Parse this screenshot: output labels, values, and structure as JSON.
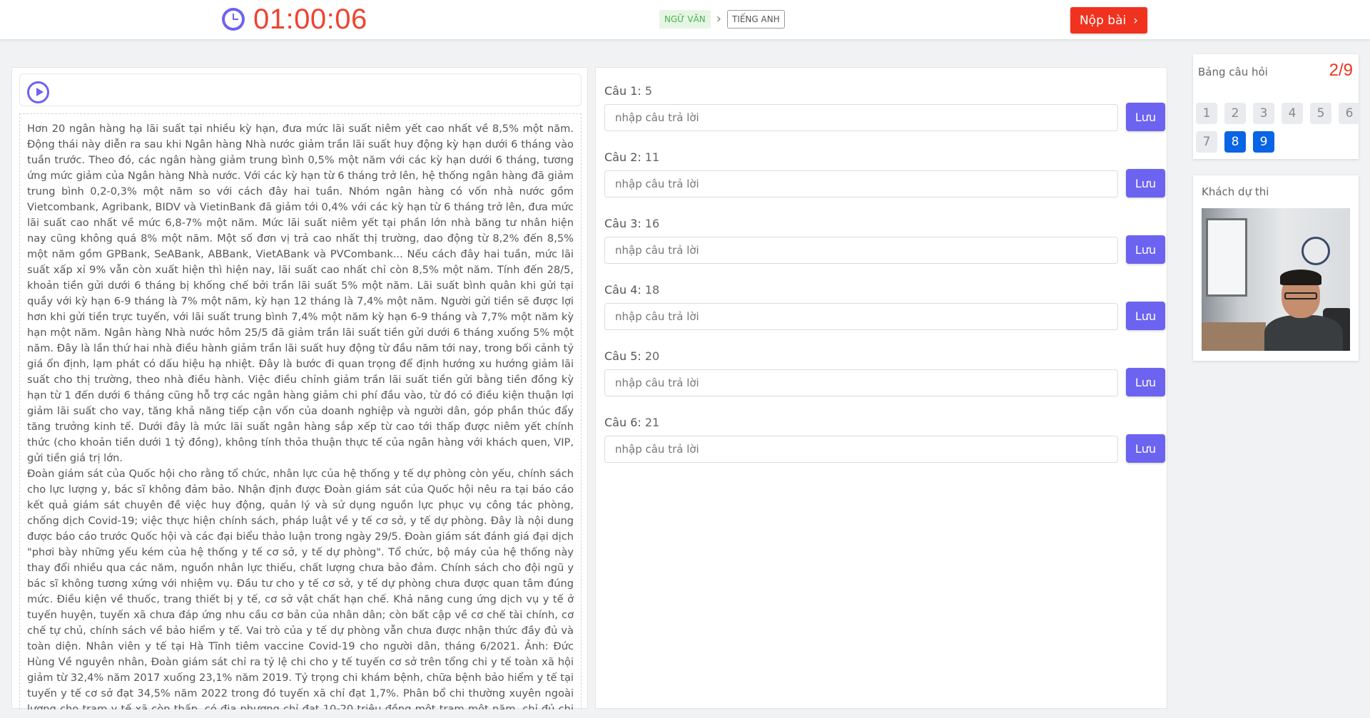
{
  "header": {
    "timer": "01:00:06",
    "subjects": [
      "NGỮ VĂN",
      "TIẾNG ANH"
    ],
    "submit_label": "Nộp bài",
    "submit_arrow": "›"
  },
  "passage": {
    "paragraphs": [
      "Hơn 20 ngân hàng hạ lãi suất tại nhiều kỳ hạn, đưa mức lãi suất niêm yết cao nhất về 8,5% một năm. Động thái này diễn ra sau khi Ngân hàng Nhà nước giảm trần lãi suất huy động kỳ hạn dưới 6 tháng vào tuần trước. Theo đó, các ngân hàng giảm trung bình 0,5% một năm với các kỳ hạn dưới 6 tháng, tương ứng mức giảm của Ngân hàng Nhà nước. Với các kỳ hạn từ 6 tháng trở lên, hệ thống ngân hàng đã giảm trung bình 0,2-0,3% một năm so với cách đây hai tuần. Nhóm ngân hàng có vốn nhà nước gồm Vietcombank, Agribank, BIDV và VietinBank đã giảm tới 0,4% với các kỳ hạn từ 6 tháng trở lên, đưa mức lãi suất cao nhất về mức 6,8-7% một năm. Mức lãi suất niêm yết tại phần lớn nhà băng tư nhân hiện nay cũng không quá 8% một năm. Một số đơn vị trả cao nhất thị trường, dao động từ 8,2% đến 8,5% một năm gồm GPBank, SeABank, ABBank, VietABank và PVCombank... Nếu cách đây hai tuần, mức lãi suất xấp xỉ 9% vẫn còn xuất hiện thì hiện nay, lãi suất cao nhất chỉ còn 8,5% một năm. Tính đến 28/5, khoản tiền gửi dưới 6 tháng bị khống chế bởi trần lãi suất 5% một năm. Lãi suất bình quân khi gửi tại quầy với kỳ hạn 6-9 tháng là 7% một năm, kỳ hạn 12 tháng là 7,4% một năm. Người gửi tiền sẽ được lợi hơn khi gửi tiền trực tuyến, với lãi suất trung bình 7,4% một năm kỳ hạn 6-9 tháng và 7,7% một năm kỳ hạn một năm. Ngân hàng Nhà nước hôm 25/5 đã giảm trần lãi suất tiền gửi dưới 6 tháng xuống 5% một năm. Đây là lần thứ hai nhà điều hành giảm trần lãi suất huy động từ đầu năm tới nay, trong bối cảnh tỷ giá ổn định, lạm phát có dấu hiệu hạ nhiệt. Đây là bước đi quan trọng để định hướng xu hướng giảm lãi suất cho thị trường, theo nhà điều hành. Việc điều chỉnh giảm trần lãi suất tiền gửi bằng tiền đồng kỳ hạn từ 1 đến dưới 6 tháng cũng hỗ trợ các ngân hàng giảm chi phí đầu vào, từ đó có điều kiện thuận lợi giảm lãi suất cho vay, tăng khả năng tiếp cận vốn của doanh nghiệp và người dân, góp phần thúc đẩy tăng trưởng kinh tế. Dưới đây là mức lãi suất ngân hàng sắp xếp từ cao tới thấp được niêm yết chính thức (cho khoản tiền dưới 1 tỷ đồng), không tính thỏa thuận thực tế của ngân hàng với khách quen, VIP, gửi tiền giá trị lớn.",
      "Đoàn giám sát của Quốc hội cho rằng tổ chức, nhân lực của hệ thống y tế dự phòng còn yếu, chính sách cho lực lượng y, bác sĩ không đảm bảo. Nhận định được Đoàn giám sát của Quốc hội nêu ra tại báo cáo kết quả giám sát chuyên đề việc huy động, quản lý và sử dụng nguồn lực phục vụ công tác phòng, chống dịch Covid-19; việc thực hiện chính sách, pháp luật về y tế cơ sở, y tế dự phòng. Đây là nội dung được báo cáo trước Quốc hội và các đại biểu thảo luận trong ngày 29/5. Đoàn giám sát đánh giá đại dịch \"phơi bày những yếu kém của hệ thống y tế cơ sở, y tế dự phòng\". Tổ chức, bộ máy của hệ thống này thay đổi nhiều qua các năm, nguồn nhân lực thiếu, chất lượng chưa bảo đảm. Chính sách cho đội ngũ y bác sĩ không tương xứng với nhiệm vụ. Đầu tư cho y tế cơ sở, y tế dự phòng chưa được quan tâm đúng mức. Điều kiện về thuốc, trang thiết bị y tế, cơ sở vật chất hạn chế. Khả năng cung ứng dịch vụ y tế ở tuyến huyện, tuyến xã chưa đáp ứng nhu cầu cơ bản của nhân dân; còn bất cập về cơ chế tài chính, cơ chế tự chủ, chính sách về bảo hiểm y tế. Vai trò của y tế dự phòng vẫn chưa được nhận thức đầy đủ và toàn diện. Nhân viên y tế tại Hà Tĩnh tiêm vaccine Covid-19 cho người dân, tháng 6/2021. Ảnh: Đức Hùng Về nguyên nhân, Đoàn giám sát chỉ ra tỷ lệ chi cho y tế tuyến cơ sở trên tổng chi y tế toàn xã hội giảm từ 32,4% năm 2017 xuống 23,1% năm 2019. Tỷ trọng chi khám bệnh, chữa bệnh bảo hiểm y tế tại tuyến y tế cơ sở đạt 34,5% năm 2022 trong đó tuyến xã chỉ đạt 1,7%. Phân bổ chi thường xuyên ngoài lương cho trạm y tế xã còn thấp, có địa phương chỉ đạt 10-20 triệu đồng một trạm một năm, chỉ đủ chi điện nước, hành chính. Trạm y tế xã không là đơn vị hạch toán độc"
    ]
  },
  "questions": [
    {
      "label": "Câu 1:",
      "num": "5",
      "placeholder": "nhập câu trả lời",
      "save": "Lưu"
    },
    {
      "label": "Câu 2:",
      "num": "11",
      "placeholder": "nhập câu trả lời",
      "save": "Lưu"
    },
    {
      "label": "Câu 3:",
      "num": "16",
      "placeholder": "nhập câu trả lời",
      "save": "Lưu"
    },
    {
      "label": "Câu 4:",
      "num": "18",
      "placeholder": "nhập câu trả lời",
      "save": "Lưu"
    },
    {
      "label": "Câu 5:",
      "num": "20",
      "placeholder": "nhập câu trả lời",
      "save": "Lưu"
    },
    {
      "label": "Câu 6:",
      "num": "21",
      "placeholder": "nhập câu trả lời",
      "save": "Lưu"
    }
  ],
  "question_board": {
    "title": "Bảng câu hỏi",
    "count": "2/9",
    "numbers": [
      "1",
      "2",
      "3",
      "4",
      "5",
      "6",
      "7",
      "8",
      "9"
    ],
    "answered": [
      "8",
      "9"
    ]
  },
  "candidate": {
    "title": "Khách dự thi"
  },
  "colors": {
    "accent": "#6c63f0",
    "danger": "#f0321e",
    "answered": "#0a64e6"
  }
}
